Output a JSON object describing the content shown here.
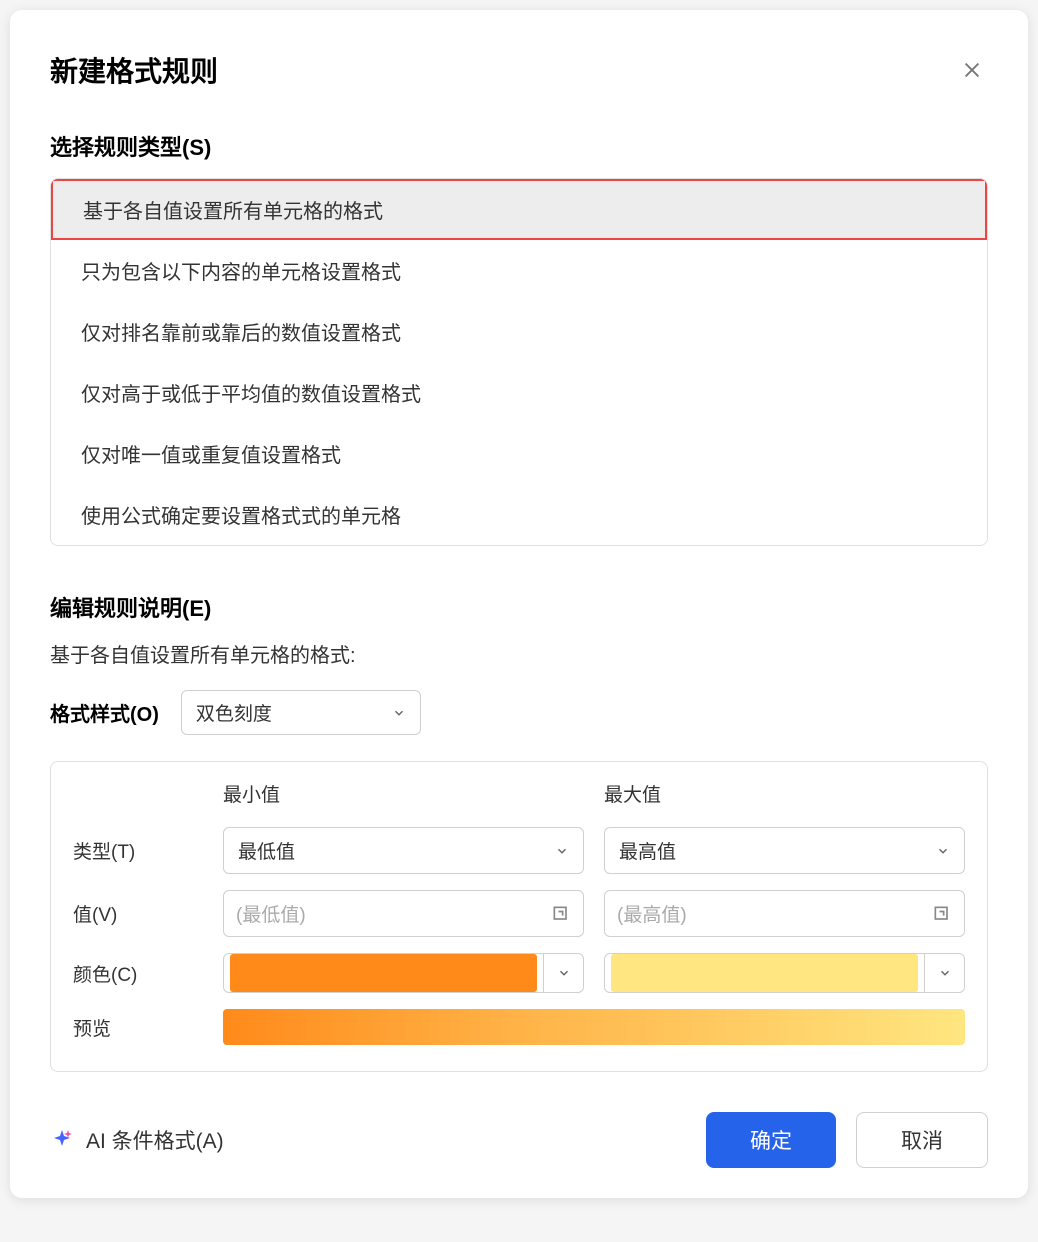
{
  "dialog": {
    "title": "新建格式规则"
  },
  "ruleSection": {
    "title": "选择规则类型(S)",
    "items": [
      "基于各自值设置所有单元格的格式",
      "只为包含以下内容的单元格设置格式",
      "仅对排名靠前或靠后的数值设置格式",
      "仅对高于或低于平均值的数值设置格式",
      "仅对唯一值或重复值设置格式",
      "使用公式确定要设置格式式的单元格"
    ]
  },
  "editSection": {
    "title": "编辑规则说明(E)",
    "description": "基于各自值设置所有单元格的格式:",
    "formatStyleLabel": "格式样式(O)",
    "formatStyleValue": "双色刻度"
  },
  "config": {
    "minHeader": "最小值",
    "maxHeader": "最大值",
    "typeLabel": "类型(T)",
    "typeMin": "最低值",
    "typeMax": "最高值",
    "valueLabel": "值(V)",
    "valueMinPlaceholder": "(最低值)",
    "valueMaxPlaceholder": "(最高值)",
    "colorLabel": "颜色(C)",
    "colorMin": "#ff8a1a",
    "colorMax": "#ffe680",
    "previewLabel": "预览"
  },
  "footer": {
    "aiLabel": "AI 条件格式(A)",
    "ok": "确定",
    "cancel": "取消"
  }
}
